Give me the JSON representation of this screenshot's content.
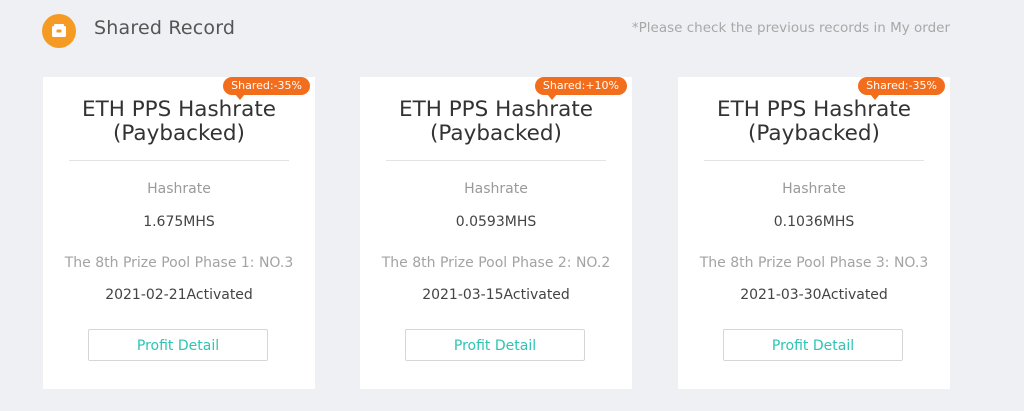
{
  "header": {
    "title": "Shared Record",
    "note": "*Please check the previous records in My order",
    "icon": "wallet-icon",
    "accent_color": "#f59a23"
  },
  "cards": [
    {
      "badge": "Shared:-35%",
      "title_line1": "ETH PPS Hashrate",
      "title_line2": "(Paybacked)",
      "hashrate_label": "Hashrate",
      "hashrate_value": "1.675MHS",
      "prize_pool": "The 8th Prize Pool Phase 1: NO.3",
      "activated": "2021-02-21Activated",
      "button": "Profit Detail"
    },
    {
      "badge": "Shared:+10%",
      "title_line1": "ETH PPS Hashrate",
      "title_line2": "(Paybacked)",
      "hashrate_label": "Hashrate",
      "hashrate_value": "0.0593MHS",
      "prize_pool": "The 8th Prize Pool Phase 2: NO.2",
      "activated": "2021-03-15Activated",
      "button": "Profit Detail"
    },
    {
      "badge": "Shared:-35%",
      "title_line1": "ETH PPS Hashrate",
      "title_line2": "(Paybacked)",
      "hashrate_label": "Hashrate",
      "hashrate_value": "0.1036MHS",
      "prize_pool": "The 8th Prize Pool Phase 3: NO.3",
      "activated": "2021-03-30Activated",
      "button": "Profit Detail"
    }
  ],
  "colors": {
    "badge": "#f26d1c",
    "button_text": "#2ec4b3",
    "background": "#eef0f3"
  }
}
